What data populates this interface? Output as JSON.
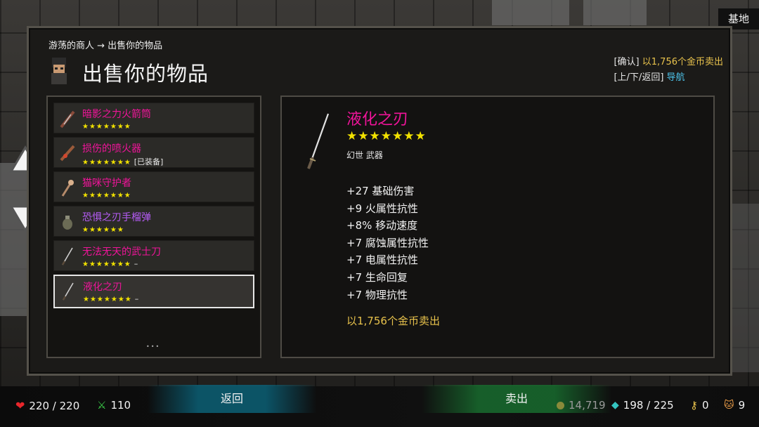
{
  "location": "基地",
  "header": {
    "breadcrumb": "游荡的商人 → 出售你的物品",
    "title": "出售你的物品"
  },
  "hints": {
    "confirm_key": "[确认]",
    "confirm_text": "以1,756个金币卖出",
    "nav_key": "[上/下/返回]",
    "nav_text": "导航"
  },
  "items": [
    {
      "name": "暗影之力火箭筒",
      "stars": "★★★★★★★",
      "tag": "",
      "rarity": "pink"
    },
    {
      "name": "损伤的喷火器",
      "stars": "★★★★★★★",
      "tag": "[已装备]",
      "rarity": "pink"
    },
    {
      "name": "猫咪守护者",
      "stars": "★★★★★★★",
      "tag": "",
      "rarity": "pink"
    },
    {
      "name": "恐惧之刃手榴弹",
      "stars": "★★★★★★",
      "tag": "",
      "rarity": "purple"
    },
    {
      "name": "无法无天的武士刀",
      "stars": "★★★★★★★",
      "tag": "–",
      "rarity": "pink"
    },
    {
      "name": "液化之刃",
      "stars": "★★★★★★★",
      "tag": "–",
      "rarity": "pink"
    }
  ],
  "pager": "•••",
  "detail": {
    "name": "液化之刃",
    "stars": "★★★★★★★",
    "type": "幻世 武器",
    "stats": [
      "+27 基础伤害",
      "+9 火属性抗性",
      "+8% 移动速度",
      "+7 腐蚀属性抗性",
      "+7 电属性抗性",
      "+7 生命回复",
      "+7 物理抗性"
    ],
    "sell_price": "以1,756个金币卖出"
  },
  "buttons": {
    "back": "返回",
    "sell": "卖出"
  },
  "hud": {
    "health": "220 / 220",
    "attack": "110",
    "gold": "14,719",
    "gems": "198 / 225",
    "keys": "0",
    "pets": "9"
  },
  "colors": {
    "legendary": "#f0149a",
    "epic": "#b55cf5",
    "stars": "#f2e200",
    "gold": "#e8c24c",
    "nav": "#4dc3ea"
  }
}
